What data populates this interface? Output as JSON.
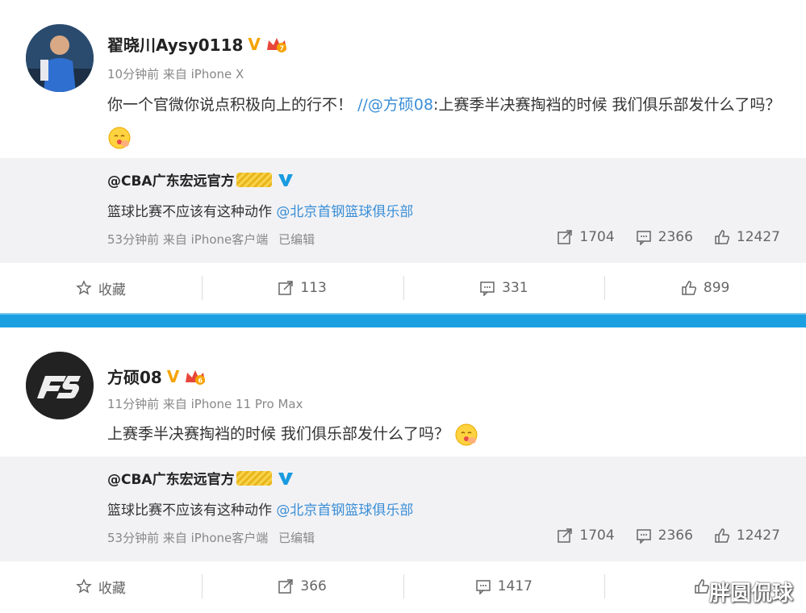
{
  "posts": [
    {
      "author": "翟晓川Aysy0118",
      "verified_badge": "V",
      "time": "10分钟前",
      "source": "来自 iPhone X",
      "content_text": "你一个官微你说点积极向上的行不！",
      "content_link": "//@方硕08",
      "content_rest": ":上赛季半决赛掏裆的时候 我们俱乐部发什么了吗？",
      "repost": {
        "author": "@CBA广东宏远官方",
        "text": "篮球比赛不应该有这种动作",
        "mention": "@北京首钢篮球俱乐部",
        "time": "53分钟前",
        "source": "来自 iPhone客户端",
        "edited": "已编辑",
        "shares": "1704",
        "comments": "2366",
        "likes": "12427"
      },
      "actions": {
        "favorite": "收藏",
        "shares": "113",
        "comments": "331",
        "likes": "899"
      }
    },
    {
      "author": "方硕08",
      "verified_badge": "V",
      "time": "11分钟前",
      "source": "来自 iPhone 11 Pro Max",
      "content_text": "上赛季半决赛掏裆的时候 我们俱乐部发什么了吗？",
      "repost": {
        "author": "@CBA广东宏远官方",
        "text": "篮球比赛不应该有这种动作",
        "mention": "@北京首钢篮球俱乐部",
        "time": "53分钟前",
        "source": "来自 iPhone客户端",
        "edited": "已编辑",
        "shares": "1704",
        "comments": "2366",
        "likes": "12427"
      },
      "actions": {
        "favorite": "收藏",
        "shares": "366",
        "comments": "1417",
        "likes": ""
      }
    }
  ],
  "watermark": "胖圆侃球",
  "colors": {
    "link": "#3a8ed6",
    "divider": "#1aa0e0",
    "repost_bg": "#f2f2f5",
    "verified_gold": "#f5a300",
    "verified_blue": "#1a9be0"
  },
  "icons": [
    "star-icon",
    "share-icon",
    "comment-icon",
    "like-icon",
    "verified-v-icon",
    "crown-icon",
    "emoji-icon"
  ]
}
